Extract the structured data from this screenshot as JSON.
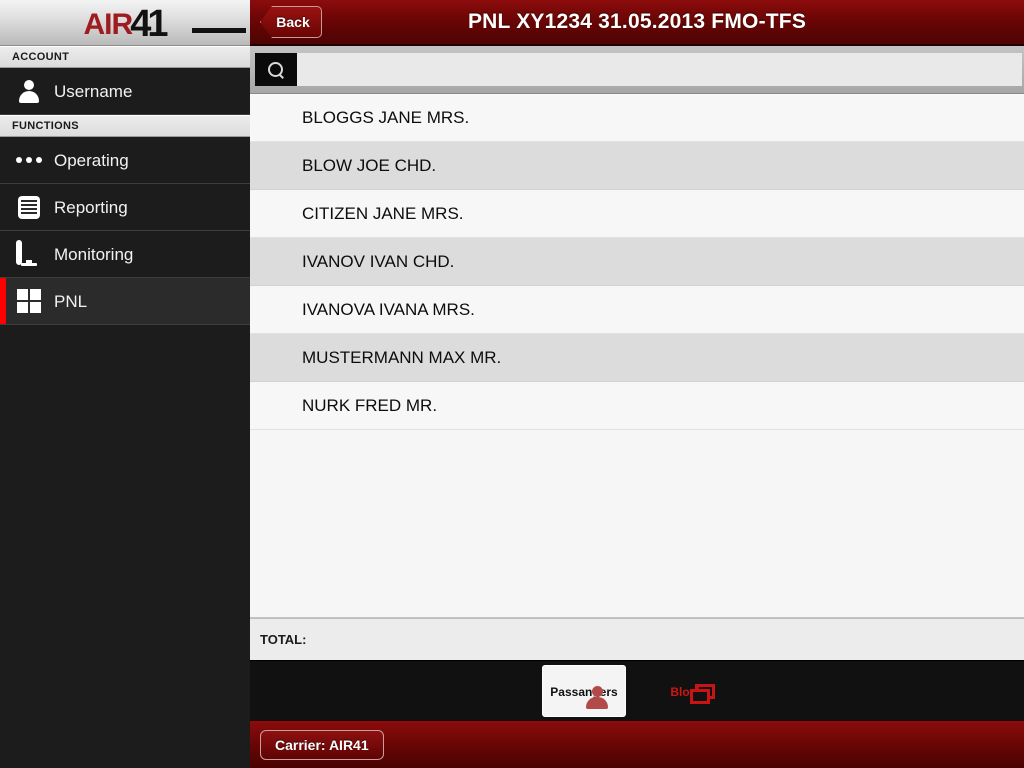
{
  "brand": {
    "logo_air": "AIR",
    "logo_num": "41",
    "accent_red": "#9e1b20",
    "selection_red": "#ff0000"
  },
  "sidebar": {
    "account_header": "ACCOUNT",
    "functions_header": "FUNCTIONS",
    "account_item": {
      "label": "Username",
      "icon": "person-icon"
    },
    "items": [
      {
        "label": "Operating",
        "icon": "dots-icon",
        "selected": false
      },
      {
        "label": "Reporting",
        "icon": "report-icon",
        "selected": false
      },
      {
        "label": "Monitoring",
        "icon": "monitor-icon",
        "selected": false
      },
      {
        "label": "PNL",
        "icon": "grid-icon",
        "selected": true
      }
    ]
  },
  "header": {
    "back_label": "Back",
    "title": "PNL XY1234 31.05.2013 FMO-TFS"
  },
  "search": {
    "icon": "search-icon",
    "value": "",
    "placeholder": ""
  },
  "passengers": {
    "rows": [
      {
        "name": "BLOGGS JANE MRS."
      },
      {
        "name": "BLOW JOE CHD."
      },
      {
        "name": "CITIZEN JANE MRS."
      },
      {
        "name": "IVANOV IVAN CHD."
      },
      {
        "name": "IVANOVA IVANA MRS."
      },
      {
        "name": "MUSTERMANN MAX MR."
      },
      {
        "name": "NURK FRED MR."
      }
    ]
  },
  "total": {
    "label": "TOTAL:",
    "value": ""
  },
  "tabs": [
    {
      "label": "Passangers",
      "icon": "person-icon",
      "active": true
    },
    {
      "label": "Blocks",
      "icon": "blocks-icon",
      "active": false
    }
  ],
  "footer": {
    "carrier_label": "Carrier: AIR41"
  }
}
